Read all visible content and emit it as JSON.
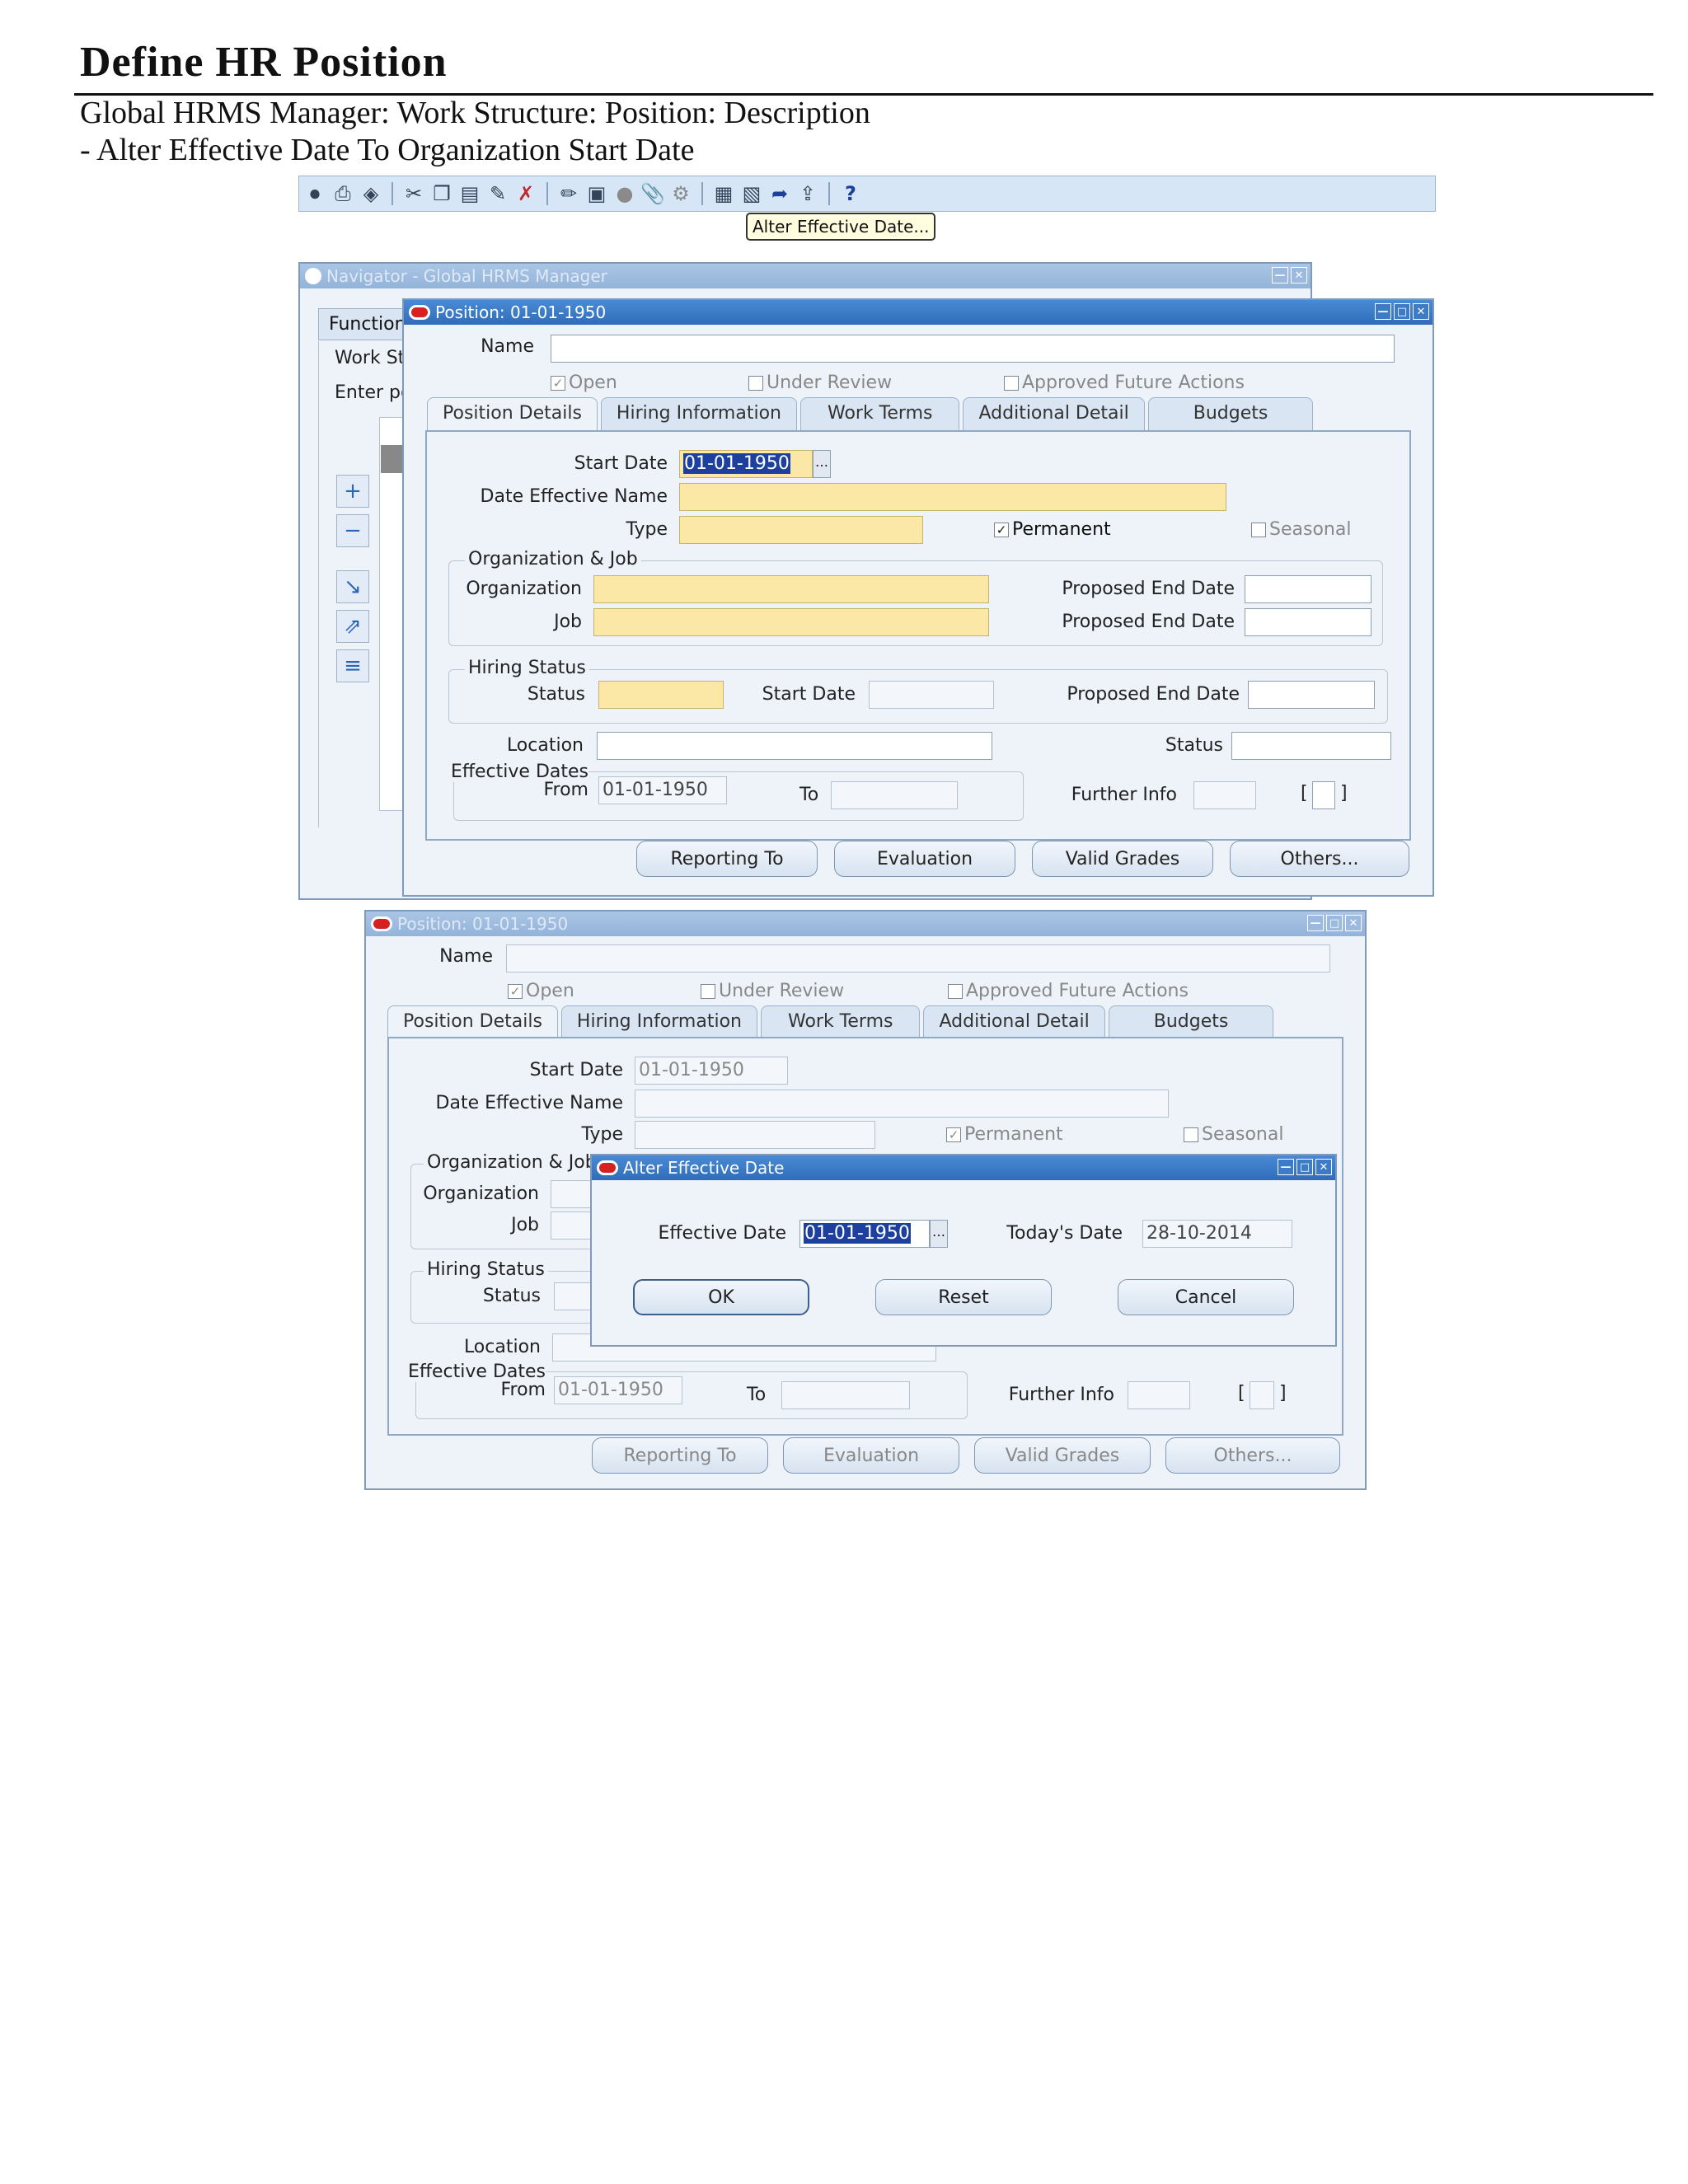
{
  "doc": {
    "title": "Define HR Position",
    "subtitle1": "Global HRMS Manager: Work Structure: Position: Description",
    "subtitle2": "- Alter Effective Date To Organization Start Date"
  },
  "toolbar": {
    "icons": [
      "save-icon",
      "print-icon",
      "switch-responsibility-icon",
      "cut-icon",
      "copy-icon",
      "paste-icon",
      "new-record-icon",
      "delete-record-icon",
      "edit-field-icon",
      "zoom-icon",
      "translation-icon",
      "attachments-icon",
      "folder-tools-icon",
      "calendar-icon",
      "alter-effective-date-icon",
      "next-step-icon",
      "export-icon",
      "help-icon"
    ],
    "tooltip": "Alter Effective Date..."
  },
  "navigator": {
    "title": "Navigator - Global HRMS Manager",
    "tab": "Function",
    "line1": "Work St",
    "line2": "Enter po"
  },
  "pos1": {
    "title": "Position: 01-01-1950",
    "name_label": "Name",
    "name_value": "",
    "open": "Open",
    "under_review": "Under Review",
    "approved": "Approved Future Actions",
    "tabs": [
      "Position Details",
      "Hiring Information",
      "Work Terms",
      "Additional Detail",
      "Budgets"
    ],
    "start_date_label": "Start Date",
    "start_date": "01-01-1950",
    "den_label": "Date Effective Name",
    "type_label": "Type",
    "permanent": "Permanent",
    "seasonal": "Seasonal",
    "org_job_group": "Organization & Job",
    "org_label": "Organization",
    "job_label": "Job",
    "ped_label": "Proposed End Date",
    "hiring_group": "Hiring Status",
    "status_label": "Status",
    "hs_start_label": "Start Date",
    "location_label": "Location",
    "eff_dates_label": "Effective Dates",
    "from_label": "From",
    "from_value": "01-01-1950",
    "to_label": "To",
    "further_info": "Further Info",
    "buttons": [
      "Reporting To",
      "Evaluation",
      "Valid Grades",
      "Others..."
    ]
  },
  "pos2": {
    "title": "Position: 01-01-1950",
    "name_label": "Name",
    "open": "Open",
    "under_review": "Under Review",
    "approved": "Approved Future Actions",
    "tabs": [
      "Position Details",
      "Hiring Information",
      "Work Terms",
      "Additional Detail",
      "Budgets"
    ],
    "start_date_label": "Start Date",
    "start_date": "01-01-1950",
    "den_label": "Date Effective Name",
    "type_label": "Type",
    "permanent": "Permanent",
    "seasonal": "Seasonal",
    "org_job_group": "Organization & Job",
    "org_label": "Organization",
    "job_label": "Job",
    "hiring_group": "Hiring Status",
    "status_label": "Status",
    "location_label": "Location",
    "eff_dates_label": "Effective Dates",
    "from_label": "From",
    "from_value": "01-01-1950",
    "to_label": "To",
    "further_info": "Further Info",
    "buttons": [
      "Reporting To",
      "Evaluation",
      "Valid Grades",
      "Others..."
    ]
  },
  "alter": {
    "title": "Alter Effective Date",
    "eff_label": "Effective Date",
    "eff_value": "01-01-1950",
    "today_label": "Today's Date",
    "today_value": "28-10-2014",
    "ok": "OK",
    "reset": "Reset",
    "cancel": "Cancel"
  }
}
